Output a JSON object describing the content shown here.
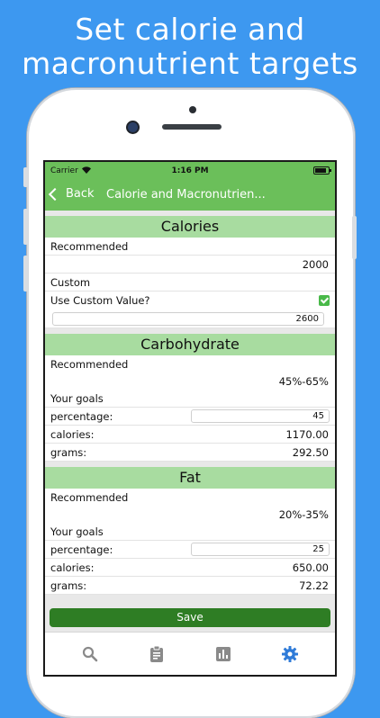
{
  "headline": [
    "Set calorie and",
    "macronutrient targets"
  ],
  "status": {
    "carrier": "Carrier",
    "time": "1:16 PM"
  },
  "nav": {
    "back_label": "Back",
    "title": "Calorie and Macronutrien..."
  },
  "calories": {
    "heading": "Calories",
    "recommended_label": "Recommended",
    "recommended_value": "2000",
    "custom_label": "Custom",
    "use_custom_label": "Use Custom Value?",
    "use_custom_checked": true,
    "custom_value": "2600"
  },
  "carbohydrate": {
    "heading": "Carbohydrate",
    "recommended_label": "Recommended",
    "recommended_value": "45%-65%",
    "goals_label": "Your goals",
    "percentage_label": "percentage:",
    "percentage_value": "45",
    "calories_label": "calories:",
    "calories_value": "1170.00",
    "grams_label": "grams:",
    "grams_value": "292.50"
  },
  "fat": {
    "heading": "Fat",
    "recommended_label": "Recommended",
    "recommended_value": "20%-35%",
    "goals_label": "Your goals",
    "percentage_label": "percentage:",
    "percentage_value": "25",
    "calories_label": "calories:",
    "calories_value": "650.00",
    "grams_label": "grams:",
    "grams_value": "72.22"
  },
  "save_label": "Save",
  "tabs": [
    {
      "icon": "search-icon",
      "active": false
    },
    {
      "icon": "clipboard-icon",
      "active": false
    },
    {
      "icon": "bar-chart-icon",
      "active": false
    },
    {
      "icon": "gear-icon",
      "active": true
    }
  ],
  "colors": {
    "background": "#3d98f0",
    "nav": "#6bbf5a",
    "section_header": "#a8dca0",
    "save": "#2e7d24",
    "tab_active": "#2f7bd8",
    "tab_inactive": "#8a8a8a"
  }
}
